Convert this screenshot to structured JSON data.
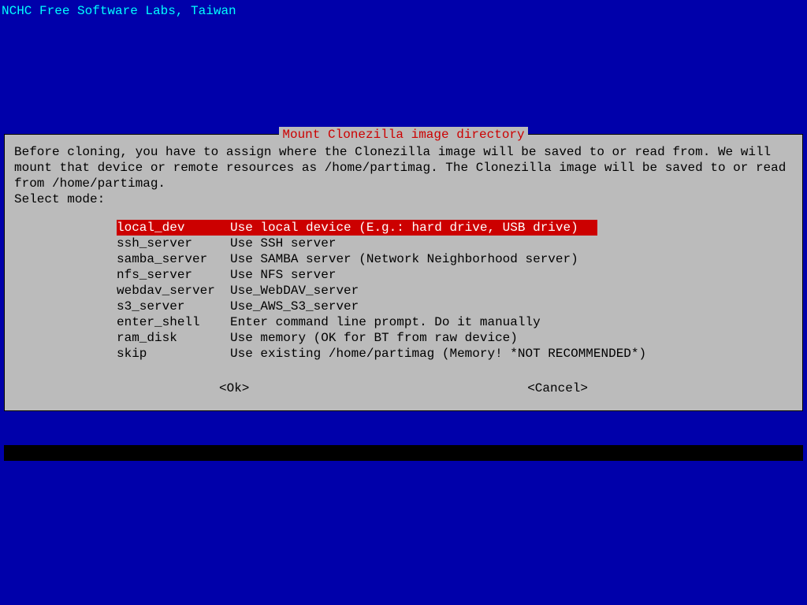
{
  "header": "NCHC Free Software Labs, Taiwan",
  "dialog": {
    "title": "Mount Clonezilla image directory",
    "message": "Before cloning, you have to assign where the Clonezilla image will be saved to or read from. We will mount that device or remote resources as /home/partimag. The Clonezilla image will be saved to or read from /home/partimag.\nSelect mode:",
    "menu": [
      {
        "key": "local_dev",
        "desc": "Use local device (E.g.: hard drive, USB drive)",
        "selected": true
      },
      {
        "key": "ssh_server",
        "desc": "Use SSH server",
        "selected": false
      },
      {
        "key": "samba_server",
        "desc": "Use SAMBA server (Network Neighborhood server)",
        "selected": false
      },
      {
        "key": "nfs_server",
        "desc": "Use NFS server",
        "selected": false
      },
      {
        "key": "webdav_server",
        "desc": "Use_WebDAV_server",
        "selected": false
      },
      {
        "key": "s3_server",
        "desc": "Use_AWS_S3_server",
        "selected": false
      },
      {
        "key": "enter_shell",
        "desc": "Enter command line prompt. Do it manually",
        "selected": false
      },
      {
        "key": "ram_disk",
        "desc": "Use memory (OK for BT from raw device)",
        "selected": false
      },
      {
        "key": "skip",
        "desc": "Use existing /home/partimag (Memory! *NOT RECOMMENDED*)",
        "selected": false
      }
    ],
    "buttons": {
      "ok": "<Ok>",
      "cancel": "<Cancel>"
    }
  }
}
